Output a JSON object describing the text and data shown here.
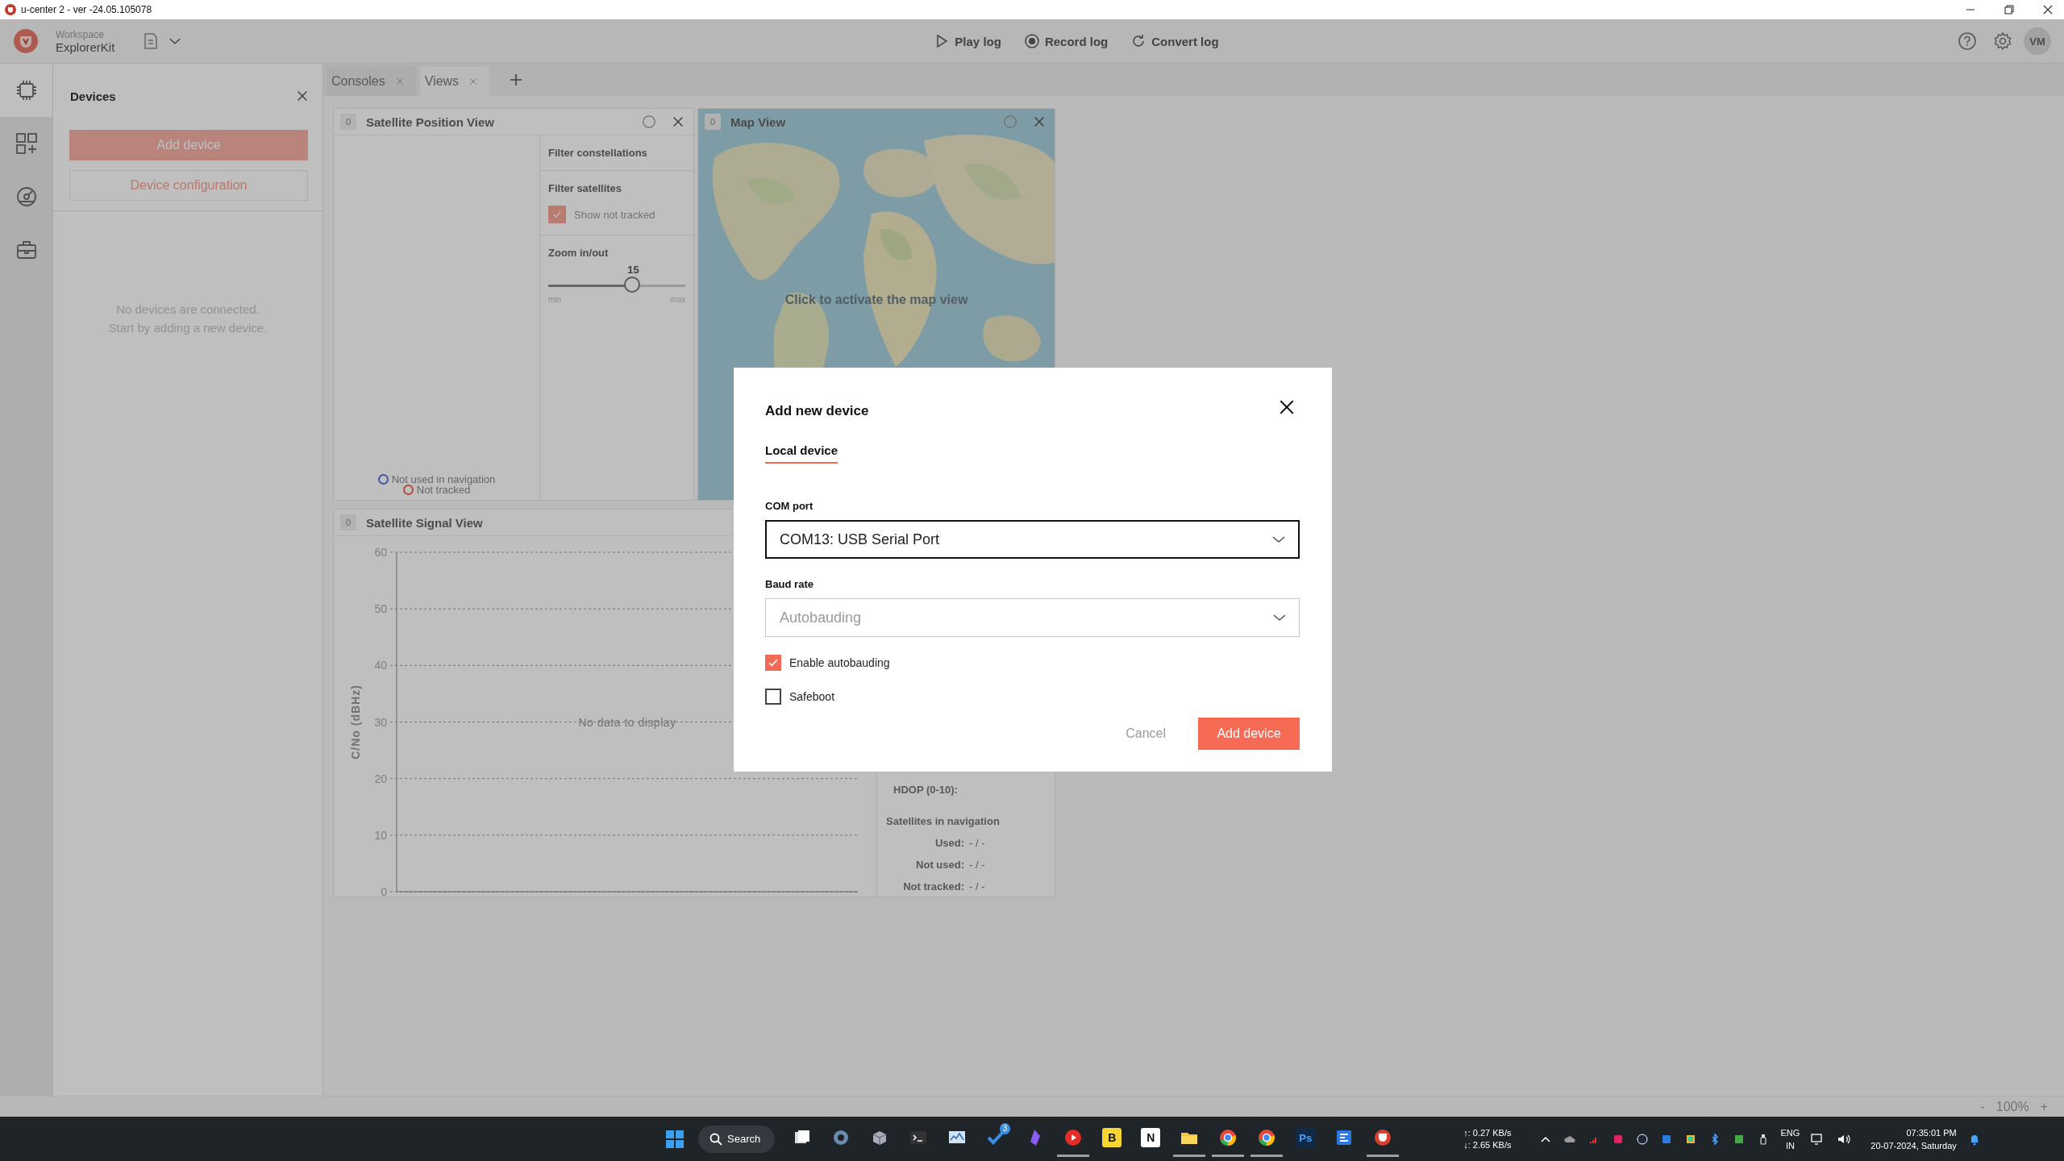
{
  "window": {
    "title": "u-center 2 - ver -24.05.105078"
  },
  "header": {
    "workspace_label": "Workspace",
    "workspace_name": "ExplorerKit",
    "actions": [
      {
        "label": "Play log",
        "kind": "play"
      },
      {
        "label": "Record log",
        "kind": "record"
      },
      {
        "label": "Convert log",
        "kind": "convert"
      }
    ],
    "avatar": "VM"
  },
  "nav_rail": [
    {
      "kind": "chip",
      "selected": true
    },
    {
      "kind": "widgets",
      "selected": false
    },
    {
      "kind": "gauge",
      "selected": false
    },
    {
      "kind": "toolbox",
      "selected": false
    }
  ],
  "devices_panel": {
    "title": "Devices",
    "buttons": [
      {
        "label": "Add device",
        "kind": "primary"
      },
      {
        "label": "Device configuration",
        "kind": "outline"
      }
    ],
    "empty_message": [
      "No devices are connected.",
      "Start by adding a new device."
    ]
  },
  "tabs": [
    {
      "label": "Consoles",
      "selected": false
    },
    {
      "label": "Views",
      "selected": true
    }
  ],
  "position_view": {
    "badge": "0",
    "title": "Satellite Position View",
    "legend": [
      {
        "label": "Not used in navigation",
        "color": "#4352a8"
      },
      {
        "label": "Not tracked",
        "color": "#b4493a"
      }
    ],
    "filters": {
      "constellations_label": "Filter constellations",
      "satellites_label": "Filter satellites",
      "show_not_tracked": {
        "label": "Show not tracked",
        "checked": true
      },
      "zoom": {
        "label": "Zoom in/out",
        "value": "15",
        "level": 0.62,
        "min_label": "min",
        "max_label": "max"
      }
    }
  },
  "map_view": {
    "badge": "0",
    "title": "Map View",
    "hint": "Click to activate the map view"
  },
  "signal_view": {
    "badge": "0",
    "title": "Satellite Signal View",
    "y_axis": {
      "label": "C/No (dBHz)",
      "ticks": [
        "60",
        "50",
        "40",
        "30",
        "20",
        "10",
        "0"
      ]
    },
    "empty_message": "No data to display",
    "stats": {
      "hdop_label": "HDOP (0-10):",
      "nav_title": "Satellites in navigation",
      "rows": [
        {
          "label": "Used:",
          "value": "- / -"
        },
        {
          "label": "Not used:",
          "value": "- / -"
        },
        {
          "label": "Not tracked:",
          "value": "- / -"
        }
      ]
    }
  },
  "status_bar": {
    "zoom_out": "-",
    "zoom": "100%",
    "zoom_in": "+"
  },
  "dialog": {
    "title": "Add new device",
    "tabs": [
      {
        "label": "Local device",
        "selected": true
      }
    ],
    "fields": [
      {
        "label": "COM port",
        "value": "COM13: USB Serial Port",
        "disabled": false
      },
      {
        "label": "Baud rate",
        "value": "Autobauding",
        "disabled": true
      }
    ],
    "options": [
      {
        "label": "Enable autobauding",
        "checked": true
      },
      {
        "label": "Safeboot",
        "checked": false
      }
    ],
    "cancel": "Cancel",
    "submit": "Add device"
  },
  "taskbar": {
    "search": "Search",
    "apps": [
      {
        "kind": "taskview",
        "running": false
      },
      {
        "kind": "gear",
        "running": false
      },
      {
        "kind": "cube",
        "running": false
      },
      {
        "kind": "terminal",
        "running": false
      },
      {
        "kind": "monitor",
        "running": false
      },
      {
        "kind": "check",
        "running": false,
        "badge": "3"
      },
      {
        "kind": "gem",
        "running": false
      },
      {
        "kind": "music",
        "running": true
      },
      {
        "kind": "letter",
        "glyph": "B",
        "running": false
      },
      {
        "kind": "letter-dark",
        "glyph": "N",
        "running": false
      },
      {
        "kind": "folder",
        "running": true
      },
      {
        "kind": "browser",
        "running": true
      },
      {
        "kind": "browser",
        "running": true
      },
      {
        "kind": "letter-blue",
        "glyph": "Ps",
        "running": false
      },
      {
        "kind": "remote",
        "running": false
      },
      {
        "kind": "ucenter",
        "running": true
      }
    ],
    "net_up": "↑: 0.27 KB/s",
    "net_down": "↓: 2.65 KB/s",
    "tray": [
      {
        "kind": "caret"
      },
      {
        "kind": "cloud"
      },
      {
        "kind": "wifi-red"
      },
      {
        "kind": "app-red"
      },
      {
        "kind": "steam"
      },
      {
        "kind": "remote"
      },
      {
        "kind": "app-color"
      },
      {
        "kind": "bluetooth"
      },
      {
        "kind": "app-green"
      },
      {
        "kind": "usb"
      }
    ],
    "lang": "ENG",
    "region": "IN",
    "time": "07:35:01 PM",
    "date": "20-07-2024, Saturday"
  }
}
